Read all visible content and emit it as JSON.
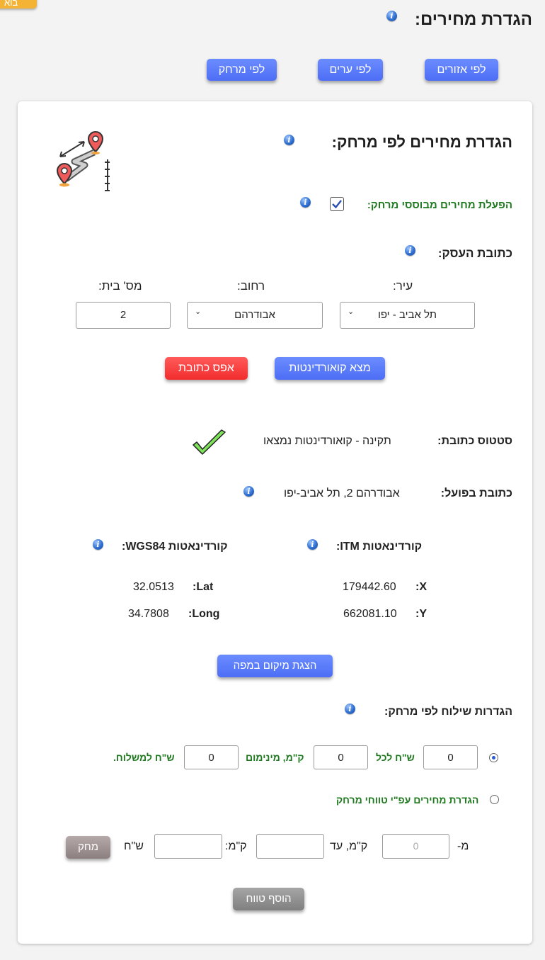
{
  "header": {
    "title": "הגדרת מחירים:",
    "corner_label": "בוא"
  },
  "tabs": [
    {
      "label": "לפי אזורים"
    },
    {
      "label": "לפי ערים"
    },
    {
      "label": "לפי מרחק"
    }
  ],
  "card": {
    "title": "הגדרת מחירים לפי מרחק:",
    "enable_label": "הפעלת מחירים מבוססי מרחק:",
    "enable_checked": true,
    "address_title": "כתובת העסק:",
    "city_label": "עיר:",
    "street_label": "רחוב:",
    "house_label": "מס' בית:",
    "city_value": "תל אביב - יפו",
    "street_value": "אבודרהם",
    "house_value": "2",
    "find_button": "מצא קואורדינטות",
    "reset_button": "אפס כתובת",
    "status_label": "סטטוס כתובת:",
    "status_value": "תקינה - קואורדינטות נמצאו",
    "actual_label": "כתובת בפועל:",
    "actual_value": "אבודרהם 2, תל אביב-יפו",
    "itm_title": "קורדינאטות ITM:",
    "wgs_title": "קורדינאטות WGS84:",
    "x_label": ":X",
    "x_value": "179442.60",
    "y_label": ":Y",
    "y_value": "662081.10",
    "lat_label": ":Lat",
    "lat_value": "32.0513",
    "long_label": ":Long",
    "long_value": "34.7808",
    "map_button": "הצגת מיקום במפה",
    "shipping_title": "הגדרות שילוח לפי מרחק:",
    "opt1": {
      "selected": true,
      "v1": "0",
      "t1": "ש\"ח לכל",
      "v2": "0",
      "t2": "ק\"מ, מינימום",
      "v3": "0",
      "t3": "ש\"ח למשלוח."
    },
    "opt2": {
      "selected": false,
      "label": "הגדרת מחירים עפ\"י טווחי מרחק"
    },
    "range": {
      "from_label": "מ-",
      "from_placeholder": "0",
      "to_label": "ק\"מ, עד",
      "price_label": "ק\"מ:",
      "currency": "ש\"ח",
      "delete_button": "מחק"
    },
    "add_range_button": "הוסף טווח"
  },
  "colors": {
    "accent": "#4d6ef5",
    "danger": "#f53b3b",
    "green": "#1f7a1f",
    "gray_button": "#8f8f8f"
  }
}
